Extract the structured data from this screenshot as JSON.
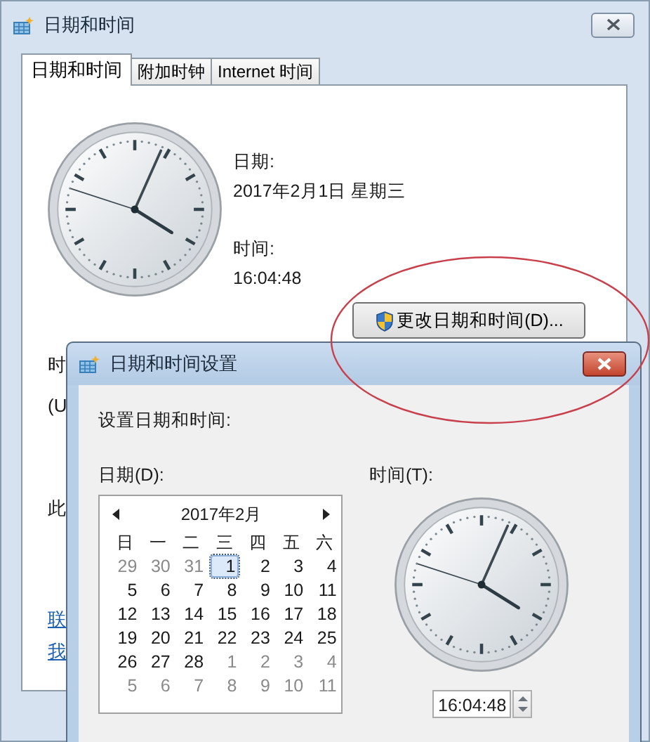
{
  "window": {
    "title": "日期和时间"
  },
  "tabs": [
    {
      "label": "日期和时间",
      "selected": true
    },
    {
      "label": "附加时钟",
      "selected": false
    },
    {
      "label": "Internet 时间",
      "selected": false
    }
  ],
  "date_label": "日期:",
  "date_value": "2017年2月1日 星期三",
  "time_label": "时间:",
  "time_value": "16:04:48",
  "change_button": "更改日期和时间(D)...",
  "hidden_texts": [
    "时",
    "(U",
    "此"
  ],
  "links": [
    "联",
    "我"
  ],
  "settings_dialog": {
    "title": "日期和时间设置",
    "heading": "设置日期和时间:",
    "date_label": "日期(D):",
    "time_label": "时间(T):",
    "time_value": "16:04:48",
    "calendar": {
      "month": "2017年2月",
      "weekdays": [
        "日",
        "一",
        "二",
        "三",
        "四",
        "五",
        "六"
      ],
      "days": [
        {
          "text": "29",
          "in_month": false,
          "selected": false
        },
        {
          "text": "30",
          "in_month": false,
          "selected": false
        },
        {
          "text": "31",
          "in_month": false,
          "selected": false
        },
        {
          "text": "1",
          "in_month": true,
          "selected": true
        },
        {
          "text": "2",
          "in_month": true,
          "selected": false
        },
        {
          "text": "3",
          "in_month": true,
          "selected": false
        },
        {
          "text": "4",
          "in_month": true,
          "selected": false
        },
        {
          "text": "5",
          "in_month": true,
          "selected": false
        },
        {
          "text": "6",
          "in_month": true,
          "selected": false
        },
        {
          "text": "7",
          "in_month": true,
          "selected": false
        },
        {
          "text": "8",
          "in_month": true,
          "selected": false
        },
        {
          "text": "9",
          "in_month": true,
          "selected": false
        },
        {
          "text": "10",
          "in_month": true,
          "selected": false
        },
        {
          "text": "11",
          "in_month": true,
          "selected": false
        },
        {
          "text": "12",
          "in_month": true,
          "selected": false
        },
        {
          "text": "13",
          "in_month": true,
          "selected": false
        },
        {
          "text": "14",
          "in_month": true,
          "selected": false
        },
        {
          "text": "15",
          "in_month": true,
          "selected": false
        },
        {
          "text": "16",
          "in_month": true,
          "selected": false
        },
        {
          "text": "17",
          "in_month": true,
          "selected": false
        },
        {
          "text": "18",
          "in_month": true,
          "selected": false
        },
        {
          "text": "19",
          "in_month": true,
          "selected": false
        },
        {
          "text": "20",
          "in_month": true,
          "selected": false
        },
        {
          "text": "21",
          "in_month": true,
          "selected": false
        },
        {
          "text": "22",
          "in_month": true,
          "selected": false
        },
        {
          "text": "23",
          "in_month": true,
          "selected": false
        },
        {
          "text": "24",
          "in_month": true,
          "selected": false
        },
        {
          "text": "25",
          "in_month": true,
          "selected": false
        },
        {
          "text": "26",
          "in_month": true,
          "selected": false
        },
        {
          "text": "27",
          "in_month": true,
          "selected": false
        },
        {
          "text": "28",
          "in_month": true,
          "selected": false
        },
        {
          "text": "1",
          "in_month": false,
          "selected": false
        },
        {
          "text": "2",
          "in_month": false,
          "selected": false
        },
        {
          "text": "3",
          "in_month": false,
          "selected": false
        },
        {
          "text": "4",
          "in_month": false,
          "selected": false
        },
        {
          "text": "5",
          "in_month": false,
          "selected": false
        },
        {
          "text": "6",
          "in_month": false,
          "selected": false
        },
        {
          "text": "7",
          "in_month": false,
          "selected": false
        },
        {
          "text": "8",
          "in_month": false,
          "selected": false
        },
        {
          "text": "9",
          "in_month": false,
          "selected": false
        },
        {
          "text": "10",
          "in_month": false,
          "selected": false
        },
        {
          "text": "11",
          "in_month": false,
          "selected": false
        }
      ]
    }
  }
}
